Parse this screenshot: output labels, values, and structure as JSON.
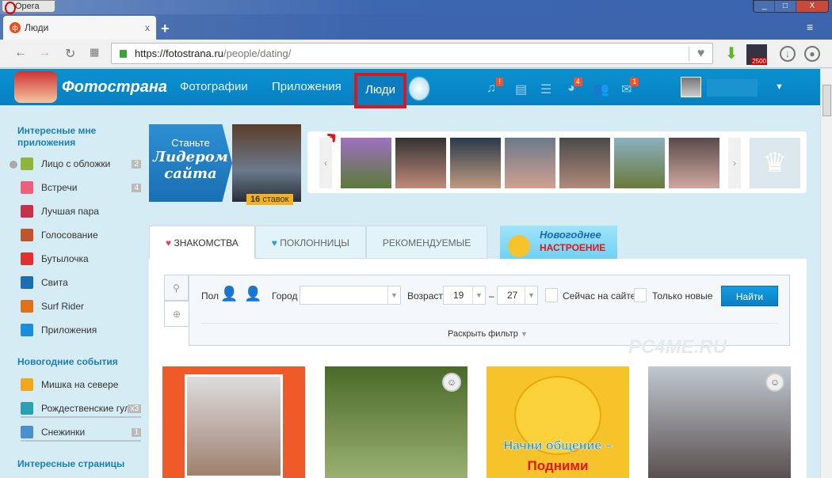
{
  "browser": {
    "app_name": "Opera",
    "window_controls": [
      "_",
      "□",
      "X"
    ],
    "tab_title": "Люди",
    "tab_close": "x",
    "new_tab": "+",
    "url_host": "https://fotostrana.ru",
    "url_path": "/people/dating/",
    "extension_badge": "2500"
  },
  "site": {
    "logo_text": "Фотострана",
    "nav": [
      "Фотографии",
      "Приложения",
      "Люди"
    ],
    "header_icons": [
      {
        "icon": "music-icon",
        "badge": "!"
      },
      {
        "icon": "news-icon",
        "badge": ""
      },
      {
        "icon": "list-icon",
        "badge": ""
      },
      {
        "icon": "games-icon",
        "badge": "4"
      },
      {
        "icon": "friends-icon",
        "badge": ""
      },
      {
        "icon": "mail-icon",
        "badge": "1"
      }
    ]
  },
  "sidebar": {
    "section1": "Интересные мне приложения",
    "items1": [
      {
        "label": "Лицо с обложки",
        "count": "2",
        "icon": "award-icon",
        "color": "#8fb43a"
      },
      {
        "label": "Встречи",
        "count": "4",
        "icon": "heart-icon",
        "color": "#f0607a"
      },
      {
        "label": "Лучшая пара",
        "count": "",
        "icon": "couple-heart-icon",
        "color": "#c8304a"
      },
      {
        "label": "Голосование",
        "count": "",
        "icon": "crown-icon",
        "color": "#c0542a"
      },
      {
        "label": "Бутылочка",
        "count": "",
        "icon": "bottle-heart-icon",
        "color": "#e03030"
      },
      {
        "label": "Свита",
        "count": "",
        "icon": "crown-blue-icon",
        "color": "#1a6fb3"
      },
      {
        "label": "Surf Rider",
        "count": "",
        "icon": "surf-rider-icon",
        "color": "#e0701a"
      },
      {
        "label": "Приложения",
        "count": "",
        "icon": "gamepad-icon",
        "color": "#1a8fe0"
      }
    ],
    "section2": "Новогодние события",
    "items2": [
      {
        "label": "Мишка на севере",
        "count": "",
        "icon": "star-icon",
        "color": "#f2a81a"
      },
      {
        "label": "Рождественские гулян",
        "count": "x3",
        "icon": "sparkle-icon",
        "color": "#2aa0b0"
      },
      {
        "label": "Снежинки",
        "count": "1",
        "icon": "snowflake-icon",
        "color": "#4a8fd0"
      }
    ],
    "section3": "Интересные страницы"
  },
  "leader": {
    "line1": "Станьте",
    "line2": "Лидером",
    "line3": "сайта",
    "bids_count": "16",
    "bids_label": "ставок"
  },
  "tabs": [
    "ЗНАКОМСТВА",
    "ПОКЛОННИЦЫ",
    "РЕКОМЕНДУЕМЫЕ"
  ],
  "ny_banner": {
    "line1": "Новогоднее",
    "line2": "НАСТРОЕНИЕ"
  },
  "filter": {
    "gender_label": "Пол",
    "city_label": "Город",
    "city_value": "",
    "age_label": "Возраст",
    "age_from": "19",
    "age_dash": "–",
    "age_to": "27",
    "online_label": "Сейчас на сайте",
    "new_label": "Только новые",
    "find_button": "Найти",
    "expand_label": "Раскрыть фильтр"
  },
  "cards": [
    {
      "color": "#f05a28"
    },
    {
      "color": "#6a8a4a"
    },
    {
      "color": "#f7c32b",
      "text1": "Начни общение –",
      "text2": "Подними"
    },
    {
      "color": "#8a9aa8"
    }
  ],
  "watermark": "PC4ME.RU"
}
